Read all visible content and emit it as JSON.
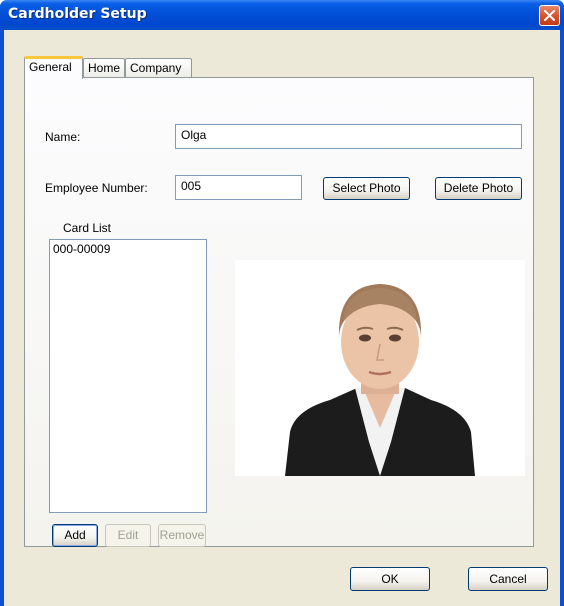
{
  "window": {
    "title": "Cardholder Setup"
  },
  "tabs": [
    {
      "label": "General"
    },
    {
      "label": "Home"
    },
    {
      "label": "Company"
    }
  ],
  "general": {
    "name_label": "Name:",
    "name_value": "Olga",
    "employee_number_label": "Employee Number:",
    "employee_number_value": "005",
    "select_photo_label": "Select Photo",
    "delete_photo_label": "Delete Photo",
    "card_list_label": "Card List",
    "card_list_items": [
      "000-00009"
    ],
    "add_label": "Add",
    "edit_label": "Edit",
    "remove_label": "Remove"
  },
  "footer": {
    "ok_label": "OK",
    "cancel_label": "Cancel"
  },
  "colors": {
    "titlebar": "#0250d8",
    "dialog_face": "#ece9d8",
    "active_tab_accent": "#ffc83c",
    "close_button": "#d8542c"
  },
  "icons": {
    "close": "close-icon"
  }
}
